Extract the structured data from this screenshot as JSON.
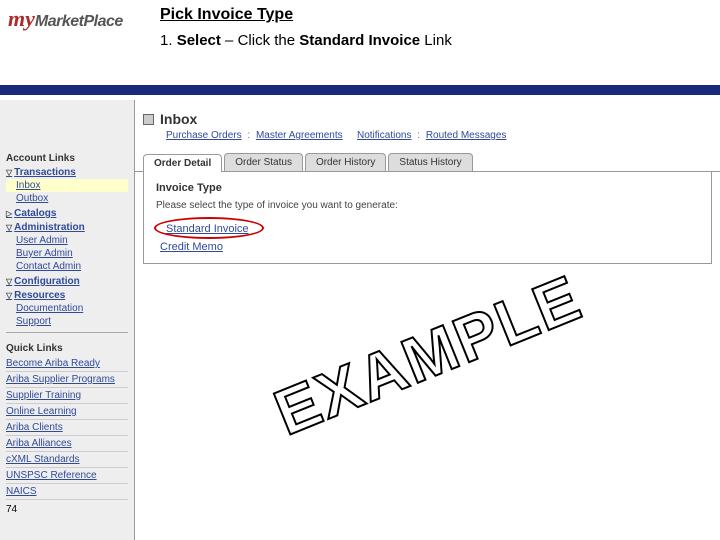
{
  "logo": {
    "my": "my",
    "market": "MarketPlace"
  },
  "instruction": {
    "title": "Pick Invoice Type",
    "step_num": "1.",
    "select": "Select",
    "dash": " – Click the ",
    "bold": "Standard Invoice",
    "tail": " Link"
  },
  "sidebar": {
    "account_links": "Account Links",
    "transactions": "Transactions",
    "inbox": "Inbox",
    "outbox": "Outbox",
    "catalogs": "Catalogs",
    "administration": "Administration",
    "user_admin": "User Admin",
    "buyer_admin": "Buyer Admin",
    "contact_admin": "Contact Admin",
    "configuration": "Configuration",
    "resources": "Resources",
    "documentation": "Documentation",
    "support": "Support",
    "quick_links": "Quick Links",
    "ql_ready": "Become Ariba Ready",
    "ql_programs": "Ariba Supplier Programs",
    "ql_training": "Supplier Training",
    "ql_learning": "Online Learning",
    "ql_clients": "Ariba Clients",
    "ql_alliances": "Ariba Alliances",
    "ql_cxml": "cXML Standards",
    "ql_unspsc": "UNSPSC Reference",
    "ql_naics": "NAICS"
  },
  "page_num": "74",
  "main": {
    "inbox": "Inbox",
    "crumb_po": "Purchase Orders",
    "crumb_ma": "Master Agreements",
    "crumb_notif": "Notifications",
    "crumb_rm": "Routed Messages",
    "sep": " : ",
    "tabs": {
      "order_detail": "Order Detail",
      "order_status": "Order Status",
      "order_history": "Order History",
      "status_history": "Status History"
    },
    "panel_title": "Invoice Type",
    "panel_sub": "Please select the type of invoice you want to generate:",
    "standard_invoice": "Standard Invoice",
    "credit_memo": "Credit Memo"
  },
  "watermark": "EXAMPLE"
}
